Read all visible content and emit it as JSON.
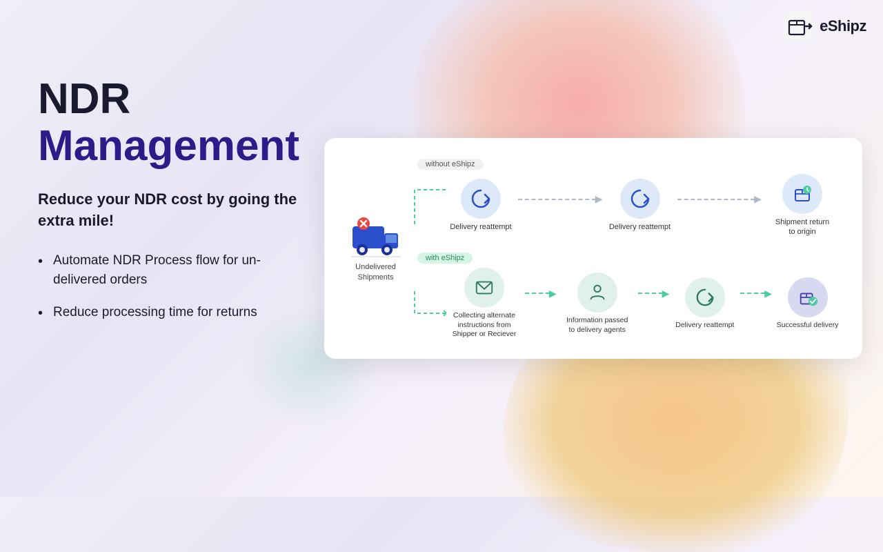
{
  "brand": {
    "name": "eShipz",
    "logo_alt": "eShipz logo"
  },
  "hero": {
    "title_line1": "NDR",
    "title_line2": "Management",
    "subtitle": "Reduce your NDR cost by going the extra mile!",
    "bullets": [
      "Automate NDR Process flow for  un-delivered orders",
      "Reduce processing time for returns"
    ]
  },
  "diagram": {
    "without_label": "without eShipz",
    "with_label": "with eShipz",
    "start_node_label": "Undelivered Shipments",
    "top_flow": [
      {
        "label": "Delivery reattempt",
        "icon": "sync"
      },
      {
        "label": "Delivery reattempt",
        "icon": "sync"
      },
      {
        "label": "Shipment return\nto origin",
        "icon": "package-return"
      }
    ],
    "bottom_flow": [
      {
        "label": "Collecting alternate\ninstructions from\nShipper or Reciever",
        "icon": "email"
      },
      {
        "label": "Information passed\nto delivery agents",
        "icon": "person"
      },
      {
        "label": "Delivery reattempt",
        "icon": "sync"
      },
      {
        "label": "Successful delivery",
        "icon": "package-check"
      }
    ]
  }
}
